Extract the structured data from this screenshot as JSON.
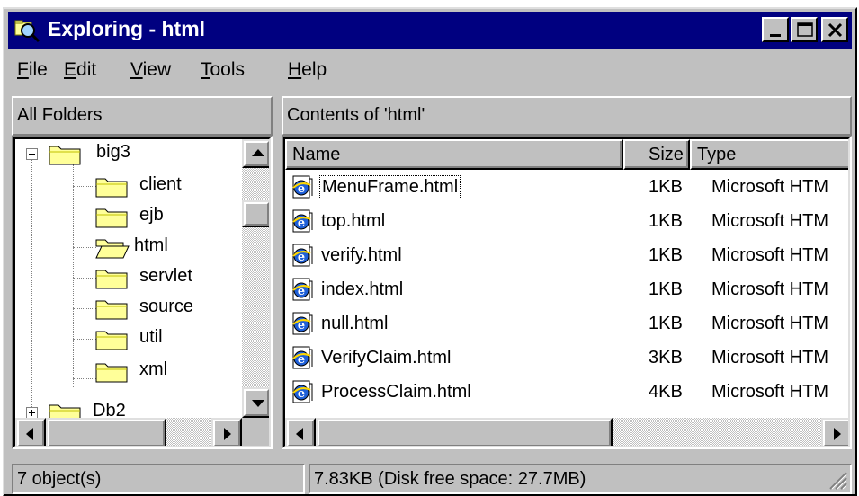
{
  "window": {
    "title": "Exploring - html"
  },
  "menu": [
    {
      "label": "File",
      "accel": "F",
      "rest": "ile"
    },
    {
      "label": "Edit",
      "accel": "E",
      "rest": "dit"
    },
    {
      "label": "View",
      "accel": "V",
      "rest": "iew"
    },
    {
      "label": "Tools",
      "accel": "T",
      "rest": "ools"
    },
    {
      "label": "Help",
      "accel": "H",
      "rest": "elp"
    }
  ],
  "left_pane": {
    "header": "All Folders",
    "tree": [
      {
        "label": "big3",
        "expanded": true,
        "expander": "minus"
      },
      {
        "label": "client"
      },
      {
        "label": "ejb"
      },
      {
        "label": "html",
        "open": true
      },
      {
        "label": "servlet"
      },
      {
        "label": "source"
      },
      {
        "label": "util"
      },
      {
        "label": "xml"
      },
      {
        "label": "Db2",
        "expander": "plus"
      }
    ]
  },
  "right_pane": {
    "header": "Contents of 'html'",
    "columns": [
      "Name",
      "Size",
      "Type"
    ],
    "rows": [
      {
        "name": "MenuFrame.html",
        "size": "1KB",
        "type": "Microsoft HTM",
        "focused": true
      },
      {
        "name": "top.html",
        "size": "1KB",
        "type": "Microsoft HTM"
      },
      {
        "name": "verify.html",
        "size": "1KB",
        "type": "Microsoft HTM"
      },
      {
        "name": "index.html",
        "size": "1KB",
        "type": "Microsoft HTM"
      },
      {
        "name": "null.html",
        "size": "1KB",
        "type": "Microsoft HTM"
      },
      {
        "name": "VerifyClaim.html",
        "size": "3KB",
        "type": "Microsoft HTM"
      },
      {
        "name": "ProcessClaim.html",
        "size": "4KB",
        "type": "Microsoft HTM"
      }
    ]
  },
  "status": {
    "objects": "7 object(s)",
    "size": "7.83KB (Disk free space: 27.7MB)"
  },
  "colors": {
    "titlebar": "#000080",
    "face": "#c0c0c0",
    "folder": "#ffff99"
  },
  "icons": {
    "title": "explorer-magnifier-icon",
    "folder": "folder-icon",
    "file": "ie-html-file-icon"
  }
}
